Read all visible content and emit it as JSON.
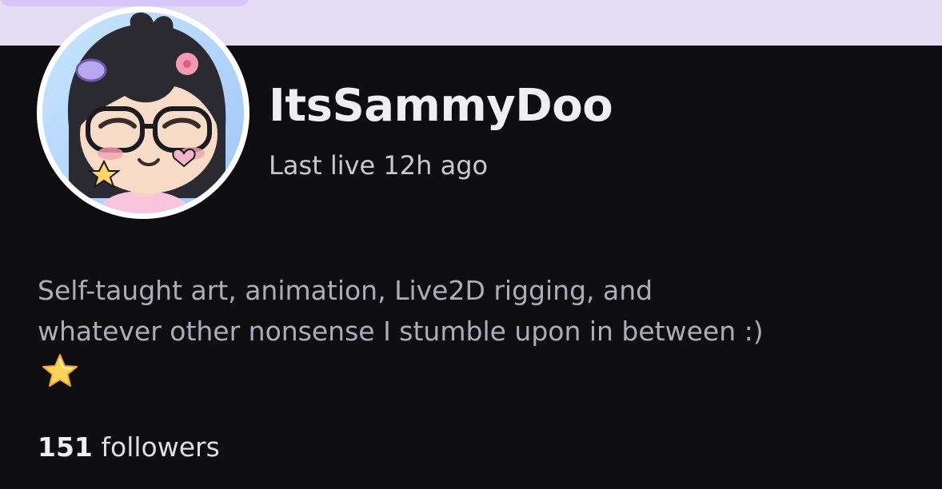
{
  "profile": {
    "channel_name": "ItsSammyDoo",
    "last_live": "Last live 12h ago",
    "avatar_icon": "avatar-illustration",
    "bio": {
      "line1": "Self-taught art, animation, Live2D rigging, and",
      "line2": "whatever other nonsense I stumble upon in between :)",
      "emoji": "star-emoji"
    },
    "followers": {
      "count": "151",
      "label": "followers"
    }
  },
  "colors": {
    "background": "#0e0e10",
    "banner": "#e3dcf3",
    "banner_pill": "#d6c6fa",
    "name_text": "#efeff1",
    "bio_text": "#adadb8"
  }
}
